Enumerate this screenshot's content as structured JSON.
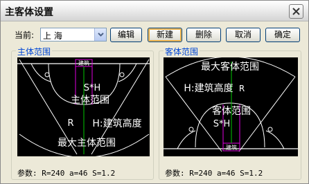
{
  "window": {
    "title": "主客体设置"
  },
  "toolbar": {
    "current_label": "当前:",
    "current_value": "上 海",
    "buttons": {
      "edit": "编辑",
      "new": "新建",
      "delete": "删除",
      "cancel": "取消",
      "ok": "确定"
    }
  },
  "host_panel": {
    "title": "主体范围",
    "labels": {
      "building": "建筑",
      "sh": "S*H",
      "range": "主体范围",
      "r": "R",
      "height": "H:建筑高度",
      "max_range": "最大主体范围"
    },
    "params": "参数: R=240 a=46 S=1.2"
  },
  "guest_panel": {
    "title": "客体范围",
    "labels": {
      "max_range": "最大客体范围",
      "height": "H:建筑高度",
      "r": "R",
      "range": "客体范围",
      "sh": "S*H",
      "building": "建筑"
    },
    "params": "参数: R=240 a=46 S=1.2"
  }
}
